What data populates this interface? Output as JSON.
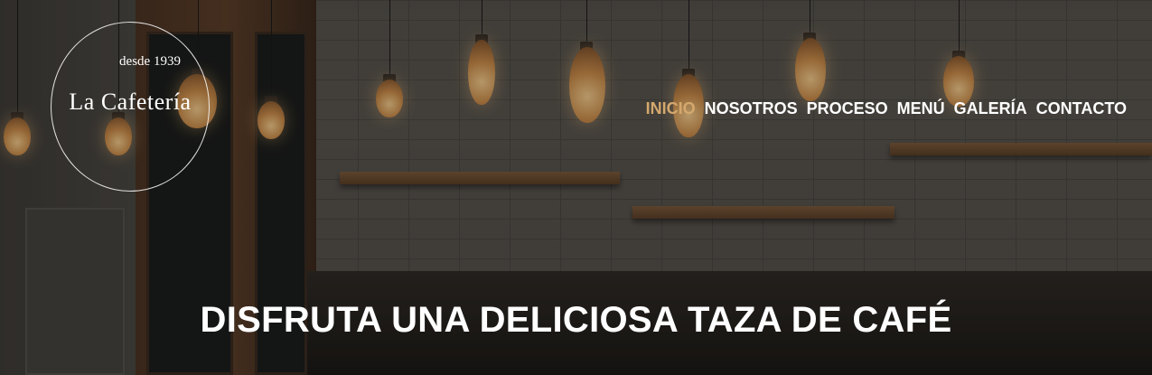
{
  "brand": {
    "since": "desde 1939",
    "name": "La Cafetería"
  },
  "nav": {
    "items": [
      {
        "label": "INICIO",
        "active": true
      },
      {
        "label": "NOSOTROS",
        "active": false
      },
      {
        "label": "PROCESO",
        "active": false
      },
      {
        "label": "MENÚ",
        "active": false
      },
      {
        "label": "GALERÍA",
        "active": false
      },
      {
        "label": "CONTACTO",
        "active": false
      }
    ]
  },
  "hero": {
    "headline": "DISFRUTA UNA DELICIOSA TAZA DE CAFÉ"
  },
  "colors": {
    "accent": "#d4a86e",
    "text": "#ffffff"
  }
}
